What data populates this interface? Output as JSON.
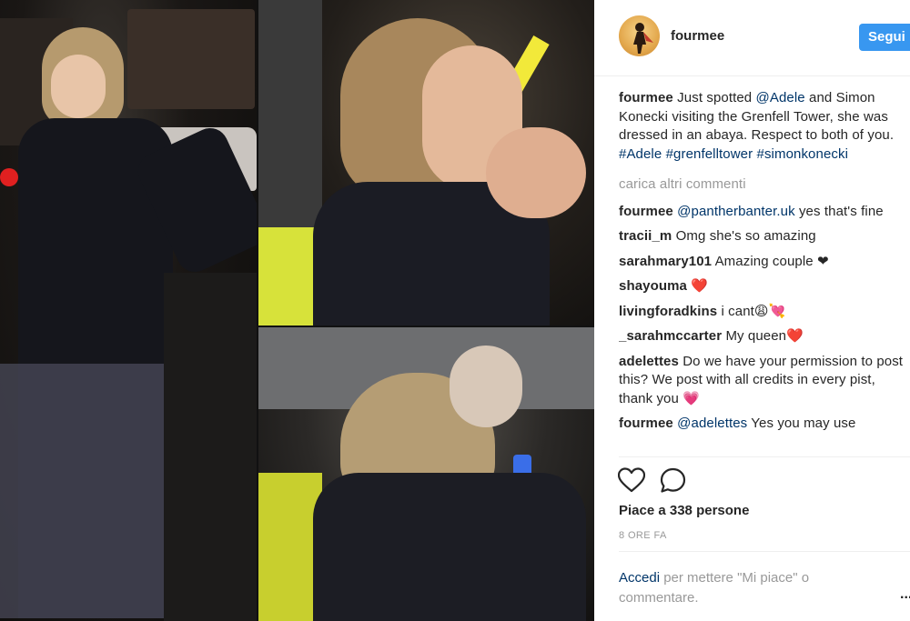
{
  "post": {
    "username": "fourmee",
    "follow_label": "Segui"
  },
  "caption": {
    "user": "fourmee",
    "text_1": "Just spotted ",
    "mention_1": "@Adele",
    "text_2": " and Simon Konecki visiting the Grenfell Tower, she was dressed in an abaya. Respect to both of you. ",
    "hashtag_1": "#Adele",
    "hashtag_2": "#grenfelltower",
    "hashtag_3": "#simonkonecki"
  },
  "load_more": "carica altri commenti",
  "comments": [
    {
      "user": "fourmee",
      "mention": "@pantherbanter.uk",
      "text": " yes that's fine"
    },
    {
      "user": "tracii_m",
      "text": "Omg she's so amazing"
    },
    {
      "user": "sarahmary101",
      "text": "Amazing couple ❤"
    },
    {
      "user": "shayouma",
      "text": "❤️"
    },
    {
      "user": "livingforadkins",
      "text": "i cant😩💘"
    },
    {
      "user": "_sarahmccarter",
      "text": "My queen❤️"
    },
    {
      "user": "adelettes",
      "text": "Do we have your permission to post this? We post with all credits in every pist, thank you 💗"
    },
    {
      "user": "fourmee",
      "mention": "@adelettes",
      "text": " Yes you may use"
    }
  ],
  "likes_text": "Piace a 338 persone",
  "timestamp": "8 ORE FA",
  "login": {
    "link": "Accedi",
    "text": " per mettere \"Mi piace\" o commentare."
  },
  "more_label": "...",
  "icons": [
    "heart-icon",
    "comment-icon"
  ],
  "colors": {
    "accent": "#3897f0",
    "link": "#003569",
    "muted": "#999999"
  }
}
